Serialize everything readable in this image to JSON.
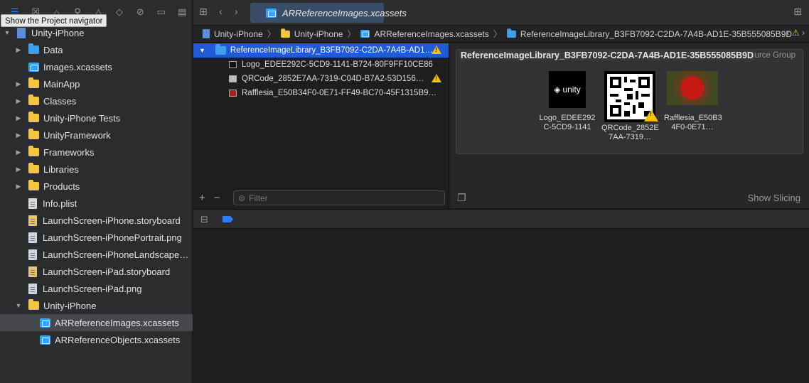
{
  "tooltip": "Show the Project navigator",
  "navigator": {
    "items": [
      {
        "label": "Unity-iPhone",
        "kind": "project",
        "level": 0,
        "disclosure": "open"
      },
      {
        "label": "Data",
        "kind": "folder-blue",
        "level": 1,
        "disclosure": "closed"
      },
      {
        "label": "Images.xcassets",
        "kind": "asset",
        "level": 1,
        "disclosure": ""
      },
      {
        "label": "MainApp",
        "kind": "folder",
        "level": 1,
        "disclosure": "closed"
      },
      {
        "label": "Classes",
        "kind": "folder",
        "level": 1,
        "disclosure": "closed"
      },
      {
        "label": "Unity-iPhone Tests",
        "kind": "folder",
        "level": 1,
        "disclosure": "closed"
      },
      {
        "label": "UnityFramework",
        "kind": "folder",
        "level": 1,
        "disclosure": "closed"
      },
      {
        "label": "Frameworks",
        "kind": "folder",
        "level": 1,
        "disclosure": "closed"
      },
      {
        "label": "Libraries",
        "kind": "folder",
        "level": 1,
        "disclosure": "closed"
      },
      {
        "label": "Products",
        "kind": "folder",
        "level": 1,
        "disclosure": "closed"
      },
      {
        "label": "Info.plist",
        "kind": "file",
        "level": 1,
        "disclosure": ""
      },
      {
        "label": "LaunchScreen-iPhone.storyboard",
        "kind": "file-sb",
        "level": 1,
        "disclosure": ""
      },
      {
        "label": "LaunchScreen-iPhonePortrait.png",
        "kind": "file-png",
        "level": 1,
        "disclosure": ""
      },
      {
        "label": "LaunchScreen-iPhoneLandscape…",
        "kind": "file-png",
        "level": 1,
        "disclosure": ""
      },
      {
        "label": "LaunchScreen-iPad.storyboard",
        "kind": "file-sb",
        "level": 1,
        "disclosure": ""
      },
      {
        "label": "LaunchScreen-iPad.png",
        "kind": "file-png",
        "level": 1,
        "disclosure": ""
      },
      {
        "label": "Unity-iPhone",
        "kind": "folder",
        "level": 1,
        "disclosure": "open"
      },
      {
        "label": "ARReferenceImages.xcassets",
        "kind": "asset",
        "level": 2,
        "disclosure": "",
        "selected": true
      },
      {
        "label": "ARReferenceObjects.xcassets",
        "kind": "asset",
        "level": 2,
        "disclosure": ""
      }
    ]
  },
  "tab": {
    "label": "ARReferenceImages.xcassets"
  },
  "jumpbar": {
    "crumbs": [
      {
        "label": "Unity-iPhone",
        "kind": "project"
      },
      {
        "label": "Unity-iPhone",
        "kind": "folder"
      },
      {
        "label": "ARReferenceImages.xcassets",
        "kind": "asset"
      },
      {
        "label": "ReferenceImageLibrary_B3FB7092-C2DA-7A4B-AD1E-35B555085B9D",
        "kind": "folder-blue"
      }
    ]
  },
  "assetlist": {
    "rows": [
      {
        "label": "ReferenceImageLibrary_B3FB7092-C2DA-7A4B-AD1…",
        "kind": "group",
        "warning": true,
        "selected": true
      },
      {
        "label": "Logo_EDEE292C-5CD9-1141-B724-80F9FF10CE86",
        "kind": "image",
        "warning": false
      },
      {
        "label": "QRCode_2852E7AA-7319-C04D-B7A2-53D156…",
        "kind": "image",
        "warning": true
      },
      {
        "label": "Rafflesia_E50B34F0-0E71-FF49-BC70-45F1315B9…",
        "kind": "image",
        "warning": false
      }
    ],
    "filter_placeholder": "Filter"
  },
  "detail": {
    "group_title": "ReferenceImageLibrary_B3FB7092-C2DA-7A4B-AD1E-35B555085B9D",
    "group_kind": "AR Resource Group",
    "images": [
      {
        "caption_line1": "Logo_EDEE292",
        "caption_line2": "C-5CD9-1141",
        "logo_text": "unity"
      },
      {
        "caption_line1": "QRCode_2852E",
        "caption_line2": "7AA-7319…"
      },
      {
        "caption_line1": "Rafflesia_E50B3",
        "caption_line2": "4F0-0E71…"
      }
    ],
    "show_slicing": "Show Slicing"
  },
  "colors": {
    "accent": "#1f5bd6",
    "warning": "#f5c400",
    "folder": "#f5c542"
  }
}
